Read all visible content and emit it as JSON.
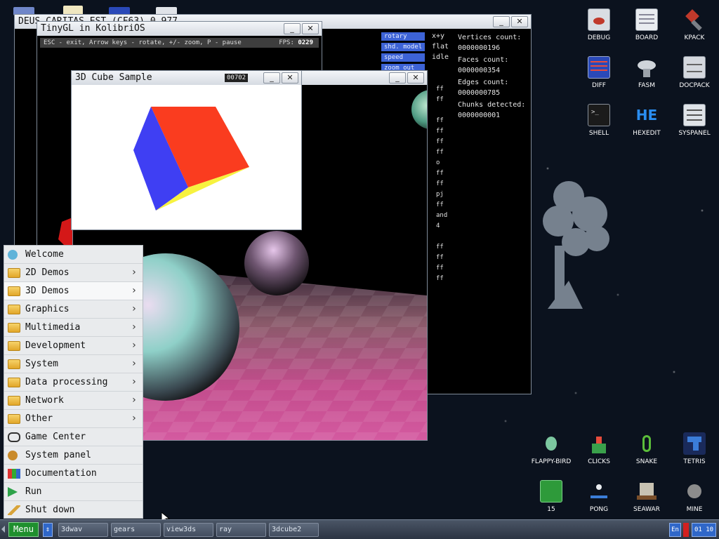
{
  "windows": {
    "deus": {
      "title": "DEUS CARITAS EST (CF63) 0.977",
      "buttons": [
        {
          "label": "rotary",
          "value": "x+y"
        },
        {
          "label": "shd. model",
          "value": "flat"
        },
        {
          "label": "speed",
          "value": "idle"
        },
        {
          "label": "zoom out",
          "value": ""
        }
      ],
      "stats": [
        {
          "label": "Vertices count:",
          "value": "0000000196"
        },
        {
          "label": "Faces count:",
          "value": "0000000354"
        },
        {
          "label": "Edges count:",
          "value": "0000000785"
        },
        {
          "label": "Chunks detected:",
          "value": "0000000001"
        }
      ],
      "side_strings": [
        "ff",
        "ff",
        "ff",
        "ff",
        "ff",
        "ff",
        "o",
        "ff",
        "ff",
        "pj",
        "ff",
        "and",
        "4",
        "ff",
        "ff",
        "ff",
        "ff"
      ]
    },
    "tinygl": {
      "title": "TinyGL in KolibriOS",
      "hint": "ESC - exit, Arrow keys - rotate, +/- zoom, P - pause",
      "fps_label": "FPS:",
      "fps_value": "0229"
    },
    "cube": {
      "title": "3D Cube Sample",
      "counter": "00702"
    },
    "controls": {
      "minimize": "_",
      "close": "✕"
    }
  },
  "desktop_icons": [
    {
      "label": "DEBUG",
      "icon": "debug-icon",
      "color": "#d9dde3"
    },
    {
      "label": "BOARD",
      "icon": "board-icon",
      "color": "#e9ecf0"
    },
    {
      "label": "KPACK",
      "icon": "kpack-icon",
      "color": "#c0392b"
    },
    {
      "label": "DIFF",
      "icon": "diff-icon",
      "color": "#2a49b8"
    },
    {
      "label": "FASM",
      "icon": "fasm-icon",
      "color": "#cfd4da"
    },
    {
      "label": "DOCPACK",
      "icon": "docpack-icon",
      "color": "#d4d8de"
    },
    {
      "label": "SHELL",
      "icon": "shell-icon",
      "color": "#1b1b1b"
    },
    {
      "label": "HEXEDIT",
      "icon": "hexedit-icon",
      "color": "#2a8df0"
    },
    {
      "label": "SYSPANEL",
      "icon": "syspanel-icon",
      "color": "#dfe3e8"
    },
    {
      "label": "FLAPPY-BIRD",
      "icon": "flappy-bird-icon",
      "color": "#7cc7a0"
    },
    {
      "label": "CLICKS",
      "icon": "clicks-icon",
      "color": "#3aa14b"
    },
    {
      "label": "SNAKE",
      "icon": "snake-icon",
      "color": "#5bbd3a"
    },
    {
      "label": "TETRIS",
      "icon": "tetris-icon",
      "color": "#3b7dd8"
    },
    {
      "label": "15",
      "icon": "fifteen-icon",
      "color": "#2e9a3a"
    },
    {
      "label": "PONG",
      "icon": "pong-icon",
      "color": "#e9ecf0"
    },
    {
      "label": "SEAWAR",
      "icon": "seawar-icon",
      "color": "#c8c2b2"
    },
    {
      "label": "MINE",
      "icon": "mine-icon",
      "color": "#8c8c8c"
    }
  ],
  "menu": {
    "items": [
      {
        "label": "Welcome",
        "icon": "bird-icon",
        "submenu": false
      },
      {
        "label": "2D Demos",
        "icon": "folder-icon",
        "submenu": true
      },
      {
        "label": "3D Demos",
        "icon": "folder-icon",
        "submenu": true,
        "active": true
      },
      {
        "label": "Graphics",
        "icon": "folder-icon",
        "submenu": true
      },
      {
        "label": "Multimedia",
        "icon": "folder-icon",
        "submenu": true
      },
      {
        "label": "Development",
        "icon": "folder-icon",
        "submenu": true
      },
      {
        "label": "System",
        "icon": "folder-icon",
        "submenu": true
      },
      {
        "label": "Data processing",
        "icon": "folder-icon",
        "submenu": true
      },
      {
        "label": "Network",
        "icon": "folder-icon",
        "submenu": true
      },
      {
        "label": "Other",
        "icon": "folder-icon",
        "submenu": true
      },
      {
        "label": "Game Center",
        "icon": "gamepad-icon",
        "submenu": false
      },
      {
        "label": "System panel",
        "icon": "gears-icon",
        "submenu": false
      },
      {
        "label": "Documentation",
        "icon": "books-icon",
        "submenu": false
      },
      {
        "label": "Run",
        "icon": "play-icon",
        "submenu": false
      },
      {
        "label": "Shut down",
        "icon": "pen-icon",
        "submenu": false
      }
    ]
  },
  "taskbar": {
    "menu_label": "Menu",
    "switch_glyph": "⇕",
    "tasks": [
      "3dwav",
      "gears",
      "view3ds",
      "ray",
      "3dcube2"
    ],
    "lang": "En",
    "clock": "01 10"
  }
}
